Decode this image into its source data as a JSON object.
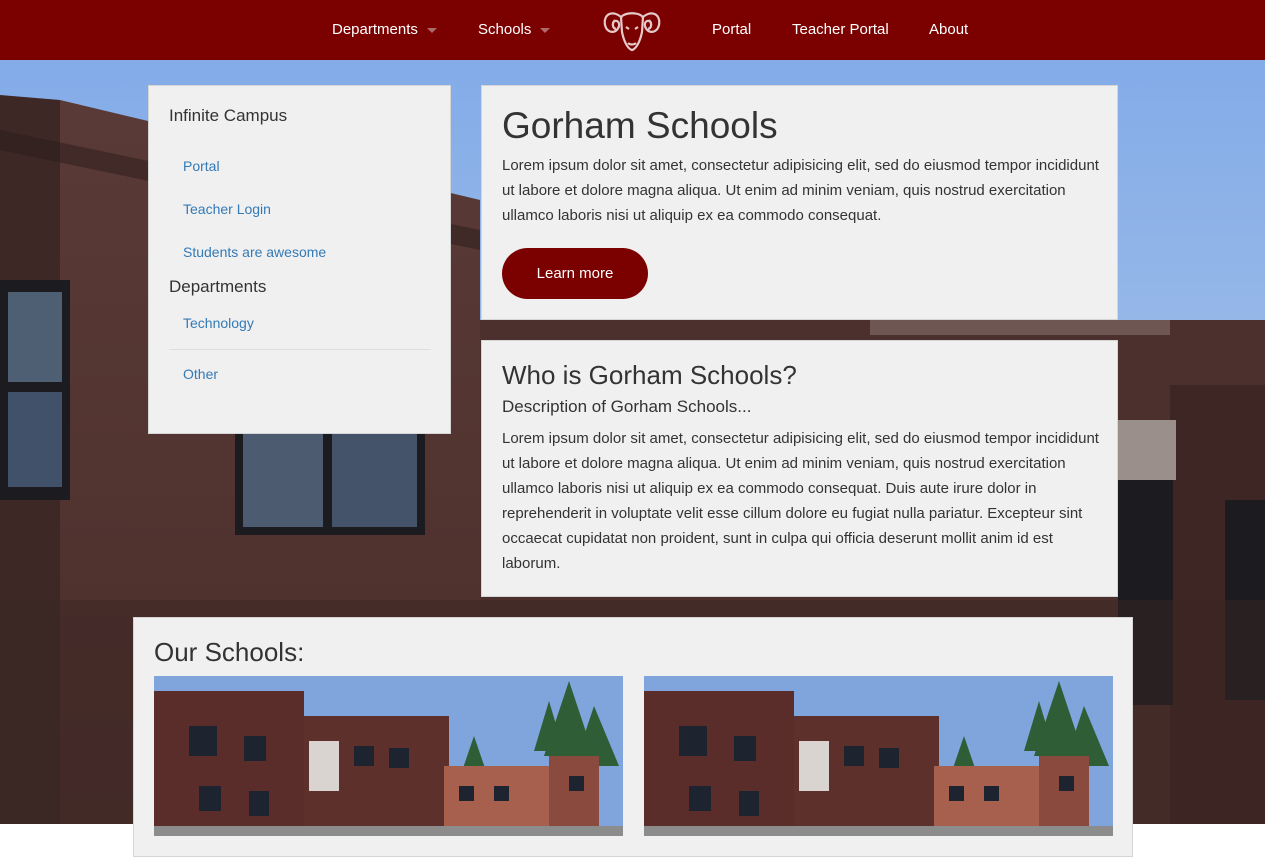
{
  "nav": {
    "departments": "Departments",
    "schools": "Schools",
    "portal": "Portal",
    "teacher_portal": "Teacher Portal",
    "about": "About",
    "accent_color": "#7b0000"
  },
  "sidebar": {
    "heading1": "Infinite Campus",
    "links1": [
      "Portal",
      "Teacher Login",
      "Students are awesome"
    ],
    "heading2": "Departments",
    "links2": [
      "Technology",
      "Other"
    ]
  },
  "hero": {
    "title": "Gorham Schools",
    "text": "Lorem ipsum dolor sit amet, consectetur adipisicing elit, sed do eiusmod tempor incididunt ut labore et dolore magna aliqua. Ut enim ad minim veniam, quis nostrud exercitation ullamco laboris nisi ut aliquip ex ea commodo consequat.",
    "button": "Learn more"
  },
  "about": {
    "title": "Who is Gorham Schools?",
    "subtitle": "Description of Gorham Schools...",
    "text": "Lorem ipsum dolor sit amet, consectetur adipisicing elit, sed do eiusmod tempor incididunt ut labore et dolore magna aliqua. Ut enim ad minim veniam, quis nostrud exercitation ullamco laboris nisi ut aliquip ex ea commodo consequat. Duis aute irure dolor in reprehenderit in voluptate velit esse cillum dolore eu fugiat nulla pariatur. Excepteur sint occaecat cupidatat non proident, sunt in culpa qui officia deserunt mollit anim id est laborum."
  },
  "schools": {
    "title": "Our Schools:"
  }
}
